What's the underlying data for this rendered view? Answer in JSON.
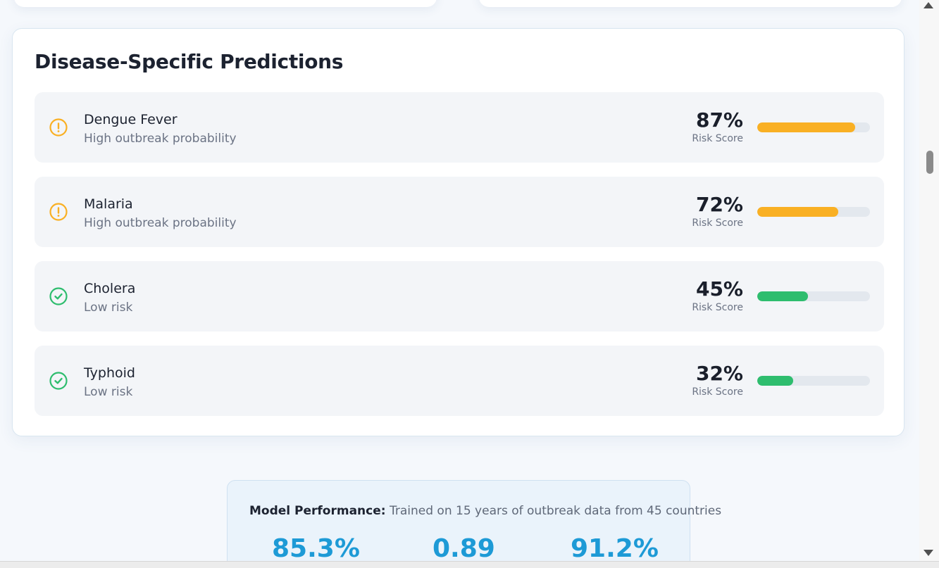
{
  "predictions": {
    "title": "Disease-Specific Predictions",
    "items": [
      {
        "name": "Dengue Fever",
        "status": "High outbreak probability",
        "score": "87%",
        "score_label": "Risk Score",
        "risk": 0.87,
        "level": "high",
        "icon": "alert-circle-icon"
      },
      {
        "name": "Malaria",
        "status": "High outbreak probability",
        "score": "72%",
        "score_label": "Risk Score",
        "risk": 0.72,
        "level": "high",
        "icon": "alert-circle-icon"
      },
      {
        "name": "Cholera",
        "status": "Low risk",
        "score": "45%",
        "score_label": "Risk Score",
        "risk": 0.45,
        "level": "low",
        "icon": "check-circle-icon"
      },
      {
        "name": "Typhoid",
        "status": "Low risk",
        "score": "32%",
        "score_label": "Risk Score",
        "risk": 0.32,
        "level": "low",
        "icon": "check-circle-icon"
      }
    ]
  },
  "model_performance": {
    "label": "Model Performance:",
    "description": "Trained on 15 years of outbreak data from 45 countries",
    "metrics": [
      "85.3%",
      "0.89",
      "91.2%"
    ]
  },
  "colors": {
    "high": "#f9b024",
    "low": "#2ebd6e",
    "metric": "#1d9ad6",
    "track": "#e3e8ee"
  }
}
